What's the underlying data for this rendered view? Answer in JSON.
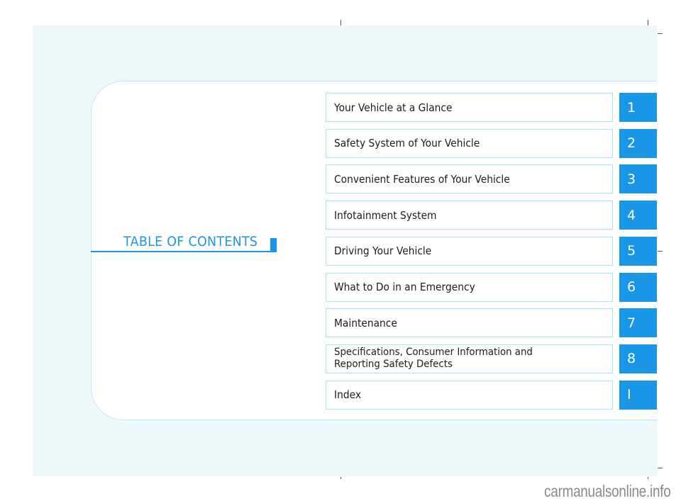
{
  "title": "TABLE OF CONTENTS",
  "colors": {
    "accent": "#1a96e6",
    "panel_background": "#eef8fb",
    "box_border": "#a9dff0"
  },
  "chapters": [
    {
      "number": "1",
      "label": "Your Vehicle at a Glance"
    },
    {
      "number": "2",
      "label": "Safety System of Your Vehicle"
    },
    {
      "number": "3",
      "label": "Convenient Features of Your Vehicle"
    },
    {
      "number": "4",
      "label": "Infotainment System"
    },
    {
      "number": "5",
      "label": "Driving Your Vehicle"
    },
    {
      "number": "6",
      "label": "What to Do in an Emergency"
    },
    {
      "number": "7",
      "label": "Maintenance"
    },
    {
      "number": "8",
      "label": "Specifications, Consumer Information and\nReporting Safety Defects"
    },
    {
      "number": "I",
      "label": "Index"
    }
  ],
  "watermark": "carmanualsonline.info"
}
